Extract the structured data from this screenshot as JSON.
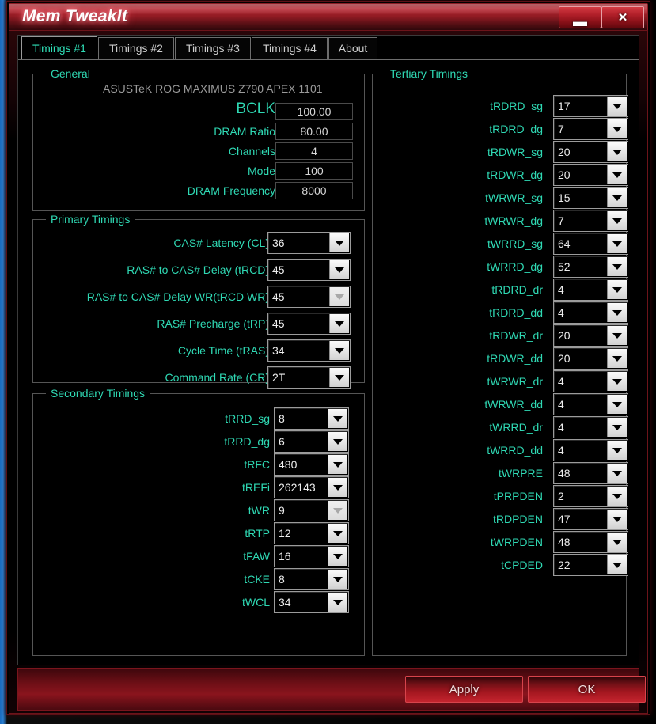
{
  "window": {
    "title": "Mem TweakIt",
    "minimize_label": "▬",
    "close_label": "✕"
  },
  "tabs": [
    {
      "label": "Timings #1",
      "active": true
    },
    {
      "label": "Timings #2",
      "active": false
    },
    {
      "label": "Timings #3",
      "active": false
    },
    {
      "label": "Timings #4",
      "active": false
    },
    {
      "label": "About",
      "active": false
    }
  ],
  "general": {
    "legend": "General",
    "board": "ASUSTeK ROG MAXIMUS Z790 APEX 1101",
    "fields": [
      {
        "label": "BCLK",
        "value": "100.00",
        "big": true
      },
      {
        "label": "DRAM Ratio",
        "value": "80.00",
        "big": false
      },
      {
        "label": "Channels",
        "value": "4",
        "big": false
      },
      {
        "label": "Mode",
        "value": "100",
        "big": false
      },
      {
        "label": "DRAM Frequency",
        "value": "8000",
        "big": false
      }
    ]
  },
  "primary": {
    "legend": "Primary Timings",
    "rows": [
      {
        "label": "CAS# Latency (CL)",
        "value": "36",
        "disabled": false
      },
      {
        "label": "RAS# to CAS# Delay (tRCD)",
        "value": "45",
        "disabled": false
      },
      {
        "label": "RAS# to CAS# Delay WR(tRCD WR)",
        "value": "45",
        "disabled": true
      },
      {
        "label": "RAS# Precharge (tRP)",
        "value": "45",
        "disabled": false
      },
      {
        "label": "Cycle Time (tRAS)",
        "value": "34",
        "disabled": false
      },
      {
        "label": "Command Rate (CR)",
        "value": "2T",
        "disabled": false
      }
    ]
  },
  "secondary": {
    "legend": "Secondary Timings",
    "rows": [
      {
        "label": "tRRD_sg",
        "value": "8",
        "disabled": false
      },
      {
        "label": "tRRD_dg",
        "value": "6",
        "disabled": false
      },
      {
        "label": "tRFC",
        "value": "480",
        "disabled": false
      },
      {
        "label": "tREFi",
        "value": "262143",
        "disabled": false
      },
      {
        "label": "tWR",
        "value": "9",
        "disabled": true
      },
      {
        "label": "tRTP",
        "value": "12",
        "disabled": false
      },
      {
        "label": "tFAW",
        "value": "16",
        "disabled": false
      },
      {
        "label": "tCKE",
        "value": "8",
        "disabled": false
      },
      {
        "label": "tWCL",
        "value": "34",
        "disabled": false
      }
    ]
  },
  "tertiary": {
    "legend": "Tertiary Timings",
    "rows": [
      {
        "label": "tRDRD_sg",
        "value": "17",
        "disabled": false
      },
      {
        "label": "tRDRD_dg",
        "value": "7",
        "disabled": false
      },
      {
        "label": "tRDWR_sg",
        "value": "20",
        "disabled": false
      },
      {
        "label": "tRDWR_dg",
        "value": "20",
        "disabled": false
      },
      {
        "label": "tWRWR_sg",
        "value": "15",
        "disabled": false
      },
      {
        "label": "tWRWR_dg",
        "value": "7",
        "disabled": false
      },
      {
        "label": "tWRRD_sg",
        "value": "64",
        "disabled": false
      },
      {
        "label": "tWRRD_dg",
        "value": "52",
        "disabled": false
      },
      {
        "label": "tRDRD_dr",
        "value": "4",
        "disabled": false
      },
      {
        "label": "tRDRD_dd",
        "value": "4",
        "disabled": false
      },
      {
        "label": "tRDWR_dr",
        "value": "20",
        "disabled": false
      },
      {
        "label": "tRDWR_dd",
        "value": "20",
        "disabled": false
      },
      {
        "label": "tWRWR_dr",
        "value": "4",
        "disabled": false
      },
      {
        "label": "tWRWR_dd",
        "value": "4",
        "disabled": false
      },
      {
        "label": "tWRRD_dr",
        "value": "4",
        "disabled": false
      },
      {
        "label": "tWRRD_dd",
        "value": "4",
        "disabled": false
      },
      {
        "label": "tWRPRE",
        "value": "48",
        "disabled": false
      },
      {
        "label": "tPRPDEN",
        "value": "2",
        "disabled": false
      },
      {
        "label": "tRDPDEN",
        "value": "47",
        "disabled": false
      },
      {
        "label": "tWRPDEN",
        "value": "48",
        "disabled": false
      },
      {
        "label": "tCPDED",
        "value": "22",
        "disabled": false
      }
    ]
  },
  "footer": {
    "apply_label": "Apply",
    "ok_label": "OK"
  },
  "colors": {
    "accent_teal": "#2fd9b4",
    "title_red": "#b02630",
    "button_red": "#a3161f"
  }
}
